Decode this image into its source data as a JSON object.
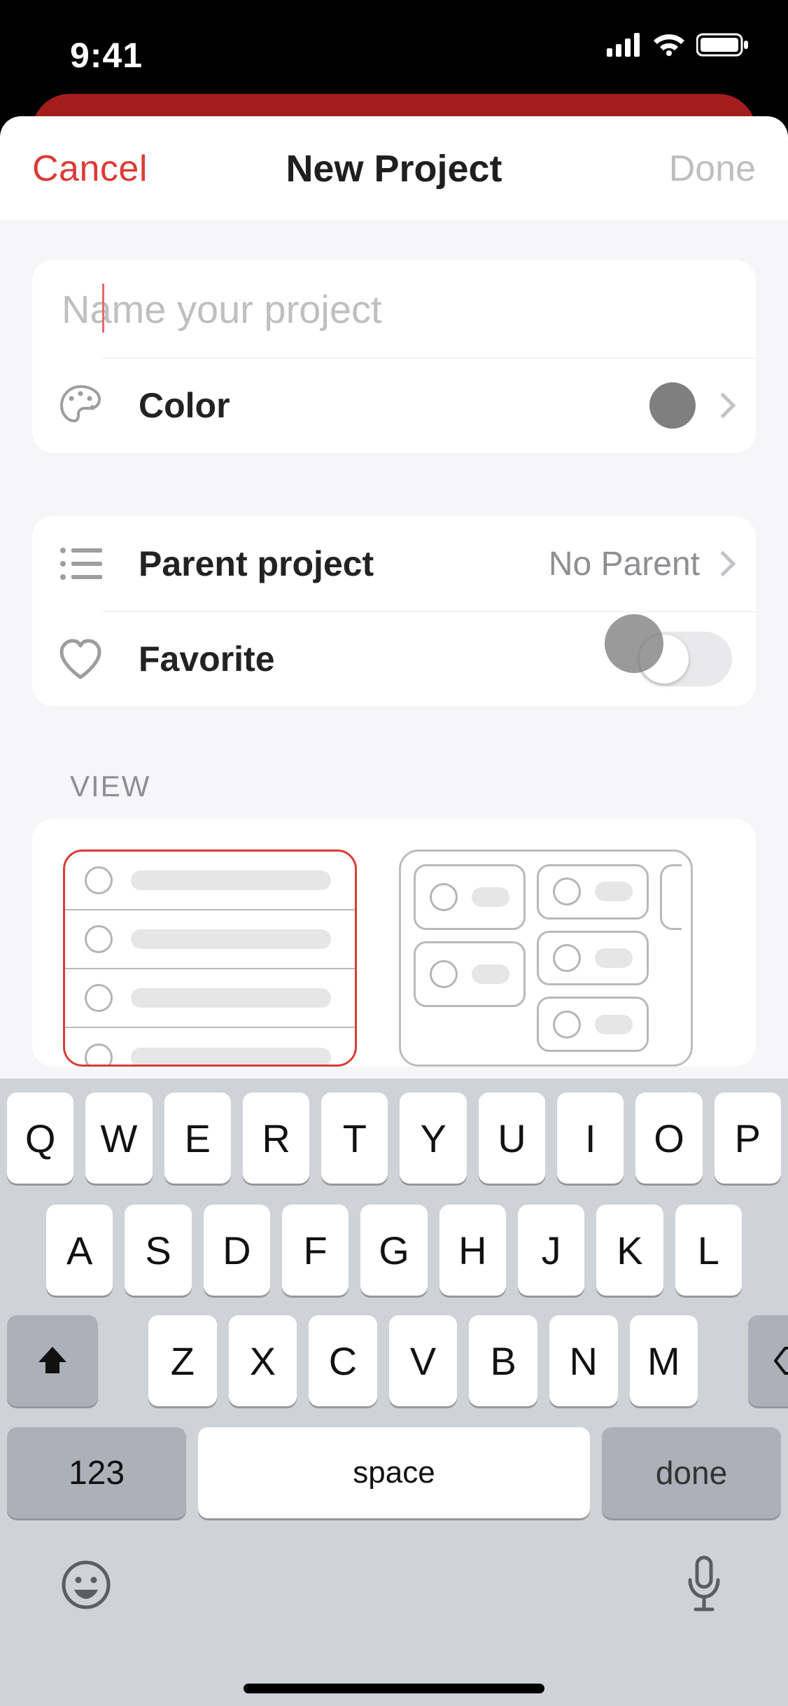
{
  "status": {
    "time": "9:41"
  },
  "nav": {
    "cancel": "Cancel",
    "title": "New Project",
    "done": "Done"
  },
  "form": {
    "name_placeholder": "Name your project",
    "name_value": "",
    "color_label": "Color",
    "color_value": "#7f7f7f",
    "parent_label": "Parent project",
    "parent_value": "No Parent",
    "favorite_label": "Favorite",
    "favorite_on": false
  },
  "view_section": {
    "header": "VIEW",
    "selected_index": 0
  },
  "keyboard": {
    "row1": [
      "Q",
      "W",
      "E",
      "R",
      "T",
      "Y",
      "U",
      "I",
      "O",
      "P"
    ],
    "row2": [
      "A",
      "S",
      "D",
      "F",
      "G",
      "H",
      "J",
      "K",
      "L"
    ],
    "row3": [
      "Z",
      "X",
      "C",
      "V",
      "B",
      "N",
      "M"
    ],
    "numbers_label": "123",
    "space_label": "space",
    "done_label": "done"
  }
}
